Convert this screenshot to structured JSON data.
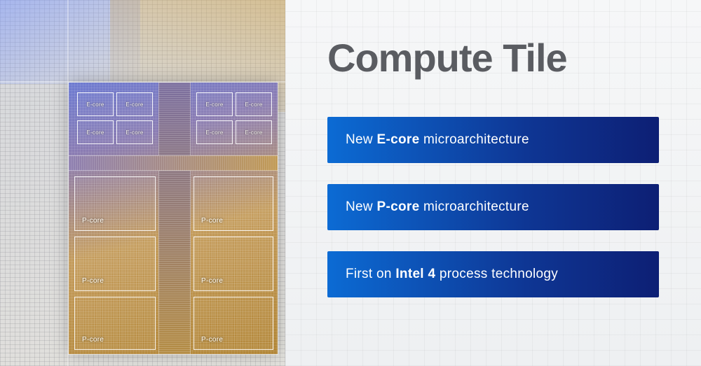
{
  "title": "Compute Tile",
  "cards": [
    {
      "prefix": "New ",
      "bold": "E-core",
      "suffix": " microarchitecture"
    },
    {
      "prefix": "New ",
      "bold": "P-core",
      "suffix": " microarchitecture"
    },
    {
      "prefix": "First on ",
      "bold": "Intel 4",
      "suffix": " process technology"
    }
  ],
  "labels": {
    "ecore": "E-core",
    "pcore": "P-core"
  },
  "colors": {
    "card_gradient_from": "#0c6bd4",
    "card_gradient_to": "#0d1f74",
    "tile_blue": "#6d7bd2",
    "tile_gold": "#b28637"
  }
}
